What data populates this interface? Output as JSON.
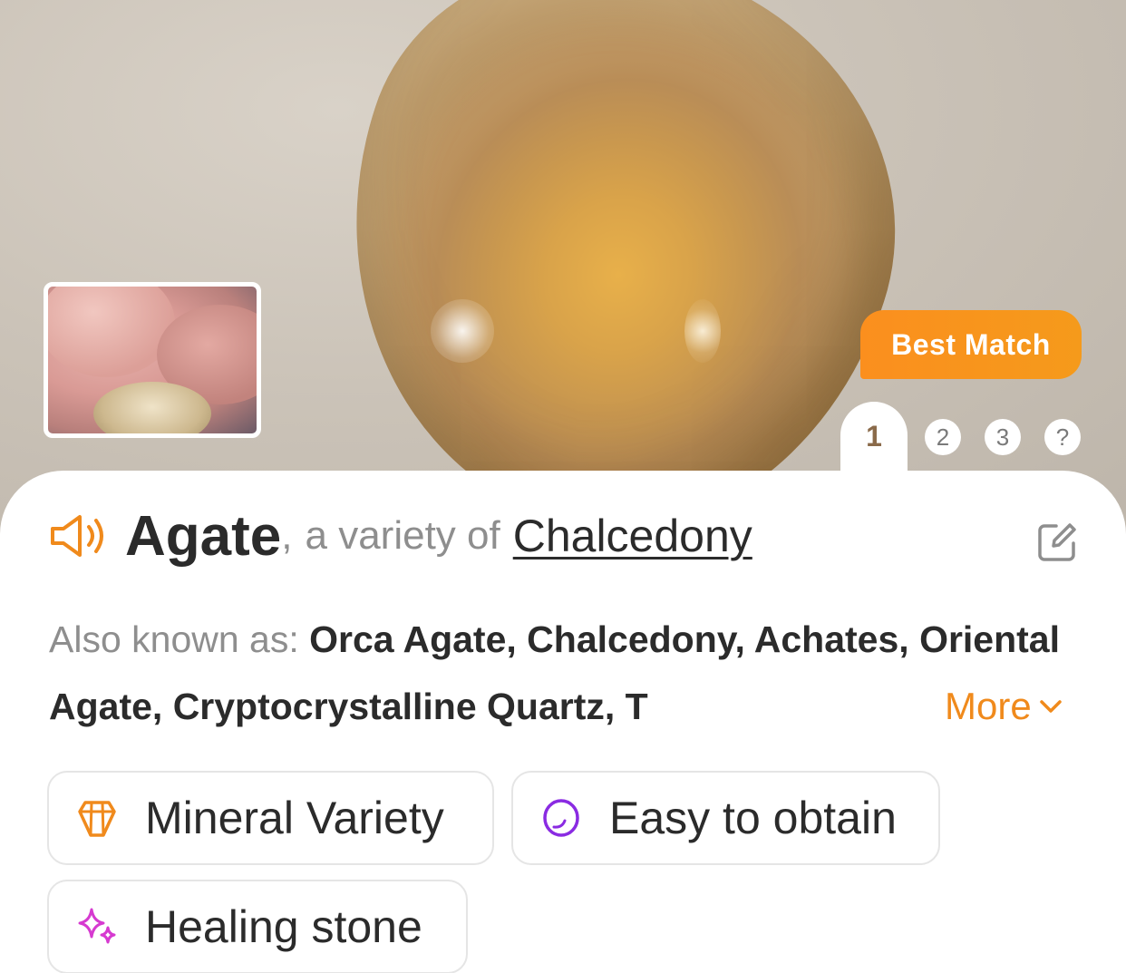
{
  "hero": {
    "badge": "Best Match",
    "ranks": [
      "1",
      "2",
      "3",
      "?"
    ],
    "active_rank": "1"
  },
  "title": {
    "name": "Agate",
    "separator": ",",
    "variety_text": "a variety of",
    "parent": "Chalcedony"
  },
  "aliases": {
    "label": "Also known as:",
    "text": "Orca Agate, Chalcedony, Achates, Oriental Agate, Cryptocrystalline Quartz, T",
    "more_label": "More"
  },
  "tags": [
    {
      "label": "Mineral Variety",
      "icon": "crystal-icon",
      "color": "#f08a1c"
    },
    {
      "label": "Easy to obtain",
      "icon": "pebble-icon",
      "color": "#8a2be2"
    },
    {
      "label": "Healing stone",
      "icon": "sparkle-icon",
      "color": "#d63ad0"
    }
  ],
  "colors": {
    "accent": "#f08a1c",
    "badge": "#fb8f1e",
    "text": "#2b2b2b",
    "muted": "#8e8e8e"
  }
}
